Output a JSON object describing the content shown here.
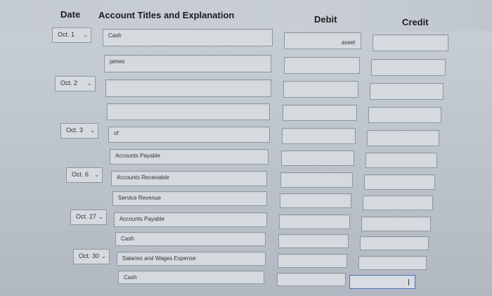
{
  "headers": {
    "date": "Date",
    "account": "Account Titles and Explanation",
    "debit": "Debit",
    "credit": "Credit"
  },
  "dates": [
    "Oct. 1",
    "Oct. 2",
    "Oct. 3",
    "Oct. 6",
    "Oct. 27",
    "Oct. 30"
  ],
  "rows": [
    {
      "account": "Cash",
      "debit": "asset"
    },
    {
      "account": "james",
      "debit": ""
    },
    {
      "account": "",
      "debit": ""
    },
    {
      "account": "",
      "debit": ""
    },
    {
      "account": "of",
      "debit": ""
    },
    {
      "account": "Accounts Payable",
      "debit": ""
    },
    {
      "account": "Accounts Receivable",
      "debit": ""
    },
    {
      "account": "Service Revenue",
      "debit": ""
    },
    {
      "account": "Accounts Payable",
      "debit": ""
    },
    {
      "account": "Cash",
      "debit": ""
    },
    {
      "account": "Salaries and Wages Expense",
      "debit": ""
    },
    {
      "account": "Cash",
      "debit": ""
    }
  ],
  "icons": {
    "dropdown": "chevron-down-icon"
  },
  "colors": {
    "focus_border": "#4a72b8"
  }
}
